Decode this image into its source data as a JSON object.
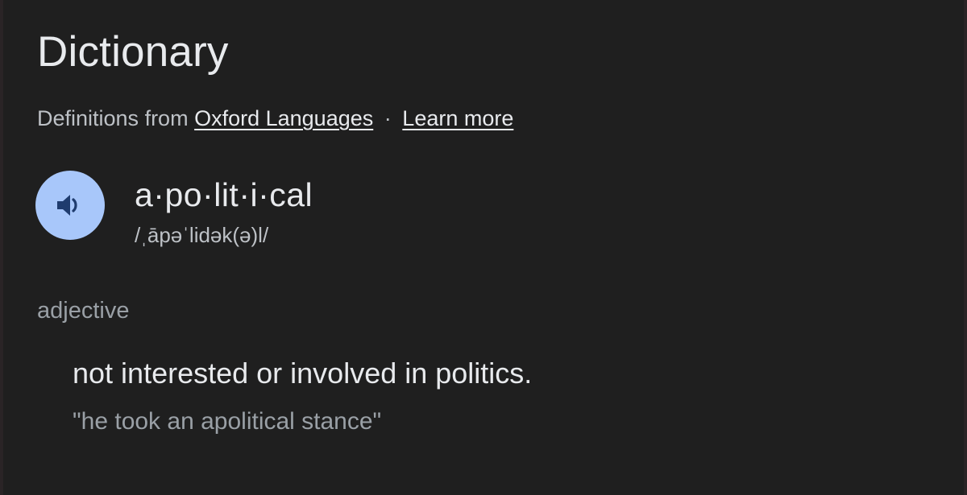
{
  "header": {
    "title": "Dictionary"
  },
  "source": {
    "prefix": "Definitions from",
    "provider_link": "Oxford Languages",
    "separator": "·",
    "learn_more_link": "Learn more"
  },
  "entry": {
    "headword": "a·po·lit·i·cal",
    "phonetic": "/ˌāpəˈlidək(ə)l/",
    "audio_icon": "speaker-icon",
    "senses": [
      {
        "part_of_speech": "adjective",
        "definition": "not interested or involved in politics.",
        "example": "\"he took an apolitical stance\""
      }
    ]
  },
  "colors": {
    "background": "#1f1f1f",
    "primary_text": "#e8eaed",
    "secondary_text": "#bdc1c6",
    "muted_text": "#9aa0a6",
    "audio_button": "#a8c7fa",
    "audio_icon": "#1f3c6e"
  }
}
